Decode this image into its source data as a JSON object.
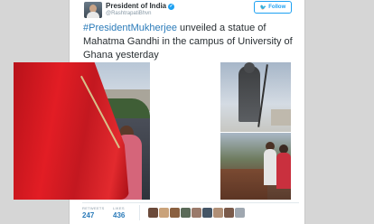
{
  "header": {
    "display_name": "President of India",
    "handle": "@RashtrapatiBhvn",
    "follow_label": "Follow"
  },
  "tweet": {
    "hashtag": "#PresidentMukherjee",
    "text": " unveiled a statue of Mahatma Gandhi in the campus of University of Ghana yesterday"
  },
  "stats": {
    "retweets_label": "RETWEETS",
    "retweets_value": "247",
    "likes_label": "LIKES",
    "likes_value": "436"
  },
  "colors": {
    "accent": "#1da1f2",
    "link": "#2b7bb9",
    "text": "#292f33",
    "muted": "#8899a6"
  },
  "icons": {
    "verified": "verified-badge-icon",
    "follow": "twitter-bird-icon"
  }
}
